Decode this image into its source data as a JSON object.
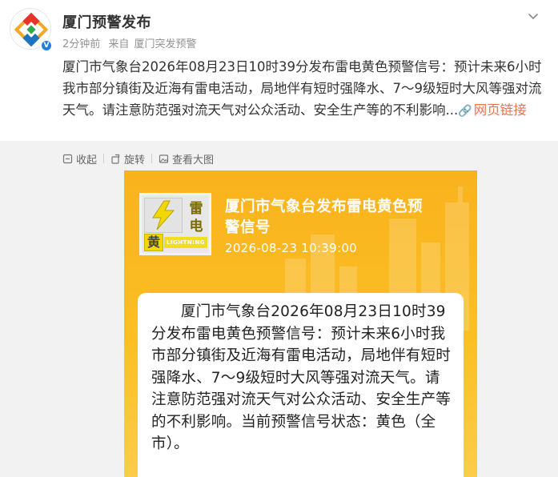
{
  "author": {
    "name": "厦门预警发布",
    "verified_icon": "verified-badge-icon"
  },
  "meta": {
    "time": "2分钟前",
    "source_prefix": "来自",
    "source": "厦门突发预警"
  },
  "post": {
    "text": "厦门市气象台2026年08月23日10时39分发布雷电黄色预警信号：预计未来6小时我市部分镇街及近海有雷电活动，局地伴有短时强降水、7～9级短时大风等强对流天气。请注意防范强对流天气对公众活动、安全生产等的不利影响...",
    "link_label": "网页链接"
  },
  "toolbar": {
    "collect": "收起",
    "rotate": "旋转",
    "view_large": "查看大图"
  },
  "poster": {
    "title": "厦门市气象台发布雷电黄色预警信号",
    "time": "2026-08-23 10:39:00",
    "signal": {
      "char1": "雷",
      "char2": "电",
      "level": "黄",
      "english": "LIGHTNING"
    },
    "body": "厦门市气象台2026年08月23日10时39分发布雷电黄色预警信号：预计未来6小时我市部分镇街及近海有雷电活动，局地伴有短时强降水、7～9级短时大风等强对流天气。请注意防范强对流天气对公众活动、安全生产等的不利影响。当前预警信号状态：黄色（全市）。"
  },
  "colors": {
    "link": "#eb7350",
    "poster_bg": "#fbbf24",
    "signal_yellow": "#f4d800"
  }
}
